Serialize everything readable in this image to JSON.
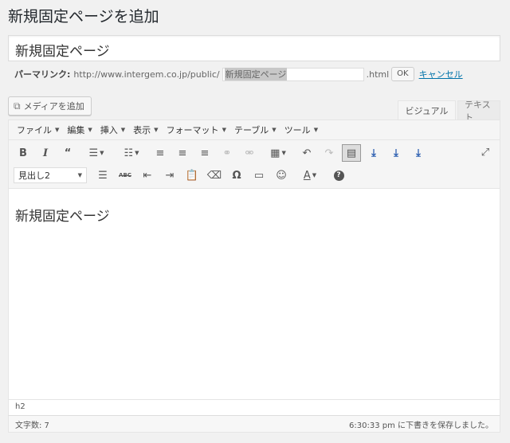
{
  "page": {
    "title": "新規固定ページを追加"
  },
  "title_field": {
    "value": "新規固定ページ"
  },
  "permalink": {
    "label": "パーマリンク:",
    "base_url": "http://www.intergem.co.jp/public/",
    "slug": "新規固定ページ",
    "suffix": ".html",
    "ok_label": "OK",
    "cancel_label": "キャンセル"
  },
  "media": {
    "button_label": "メディアを追加"
  },
  "tabs": {
    "visual": "ビジュアル",
    "text": "テキスト"
  },
  "menu": [
    {
      "label": "ファイル"
    },
    {
      "label": "編集"
    },
    {
      "label": "挿入"
    },
    {
      "label": "表示"
    },
    {
      "label": "フォーマット"
    },
    {
      "label": "テーブル"
    },
    {
      "label": "ツール"
    }
  ],
  "toolbar": {
    "format_select": "見出し2",
    "bold_glyph": "B",
    "italic_glyph": "I",
    "quote_glyph": "“",
    "strike_glyph": "ABC",
    "omega_glyph": "Ω",
    "smiley_glyph": "☺",
    "textcolor_glyph": "A",
    "help_glyph": "?"
  },
  "content": {
    "heading": "新規固定ページ"
  },
  "status": {
    "path": "h2"
  },
  "footer": {
    "word_count": "文字数: 7",
    "saved": "6:30:33 pm に下書きを保存しました。"
  }
}
